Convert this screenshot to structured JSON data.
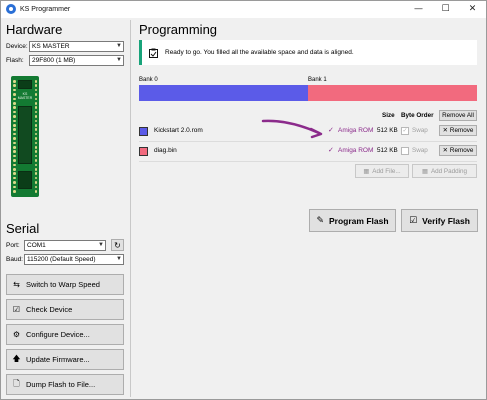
{
  "window": {
    "title": "KS Programmer",
    "icon": "app-icon"
  },
  "hardware": {
    "heading": "Hardware",
    "device_label": "Device:",
    "device_value": "KS MASTER",
    "flash_label": "Flash:",
    "flash_value": "29F800 (1 MB)",
    "board_label": "KS MASTER"
  },
  "serial": {
    "heading": "Serial",
    "port_label": "Port:",
    "port_value": "COM1",
    "baud_label": "Baud:",
    "baud_value": "115200 (Default Speed)",
    "buttons": [
      {
        "label": "Switch to Warp Speed",
        "icon": "switch-icon"
      },
      {
        "label": "Check Device",
        "icon": "checkbox-icon"
      },
      {
        "label": "Configure Device...",
        "icon": "gear-icon"
      },
      {
        "label": "Update Firmware...",
        "icon": "upload-arrow-icon"
      },
      {
        "label": "Dump Flash to File...",
        "icon": "document-icon"
      }
    ]
  },
  "programming": {
    "heading": "Programming",
    "status_text": "Ready to go. You filled all the available space and data is aligned.",
    "status_color": "#18a37a",
    "banks": [
      {
        "label": "Bank 0",
        "color": "#5b5be8"
      },
      {
        "label": "Bank 1",
        "color": "#f26a7e"
      }
    ],
    "columns": {
      "size": "Size",
      "byte_order": "Byte Order"
    },
    "remove_all_label": "Remove All",
    "files": [
      {
        "name": "Kickstart 2.0.rom",
        "type": "Amiga ROM",
        "size": "512 KB",
        "swap": "Swap",
        "remove": "Remove",
        "color": "#5b5be8"
      },
      {
        "name": "diag.bin",
        "type": "Amiga ROM",
        "size": "512 KB",
        "swap": "Swap",
        "remove": "Remove",
        "color": "#f26a7e"
      }
    ],
    "add_file_label": "Add File...",
    "add_padding_label": "Add Padding",
    "program_flash_label": "Program Flash",
    "verify_flash_label": "Verify Flash",
    "annotation_color": "#8b2b8b"
  }
}
